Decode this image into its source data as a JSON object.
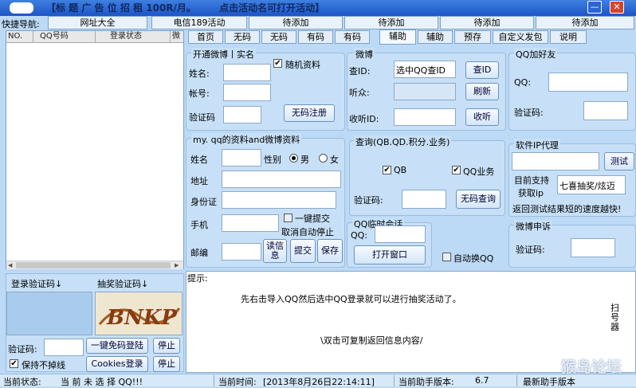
{
  "window": {
    "title": "【标 题 广 告 位 招 租 100R/月。       点击活动名可打开活动】",
    "minimize": "—",
    "close": "✕"
  },
  "quick_nav": {
    "label": "快捷导航:",
    "items": [
      "网址大全",
      "电信189活动",
      "待添加",
      "待添加",
      "待添加",
      "待添加"
    ]
  },
  "list": {
    "columns": [
      "NO.",
      "QQ号码",
      "登录状态",
      "微"
    ]
  },
  "tabs": [
    "首页",
    "无码",
    "无码",
    "有码",
    "有码",
    "辅助",
    "辅助",
    "预存",
    "自定义发包",
    "说明"
  ],
  "captcha": {
    "login_label": "登录验证码↓",
    "lottery_label": "抽奖验证码↓",
    "code_label": "验证码:",
    "one_click_btn": "一键免码登陆",
    "stop_btn": "停止",
    "cookies_btn": "Cookies登录",
    "stop_btn2": "停止",
    "keep_online": "保持不掉线",
    "captcha_text": "BNKP"
  },
  "weibo_open": {
    "title": "开通微博丨实名",
    "random_info": "随机资料",
    "name": "姓名:",
    "account": "帐号:",
    "code": "验证码",
    "register_btn": "无码注册"
  },
  "weibo": {
    "title": "微博",
    "id_label": "查ID:",
    "id_value": "选中QQ查ID",
    "check_id_btn": "查ID",
    "listeners": "听众:",
    "refresh_btn": "刷新",
    "listen_id": "收听ID:",
    "listen_btn": "收听"
  },
  "qq_friend": {
    "title": "QQ加好友",
    "qq": "QQ:",
    "code": "验证码:"
  },
  "profile": {
    "title": "my. qq的资料and微博资料",
    "name": "姓名",
    "gender": "性别",
    "male": "男",
    "female": "女",
    "address": "地址",
    "id_card": "身份证",
    "phone": "手机",
    "one_click_submit": "一键提交",
    "cancel_auto_stop": "取消自动停止",
    "zip": "邮编",
    "read_btn": "读信息",
    "submit_btn": "提交",
    "save_btn": "保存"
  },
  "query": {
    "title": "查询(QB.QD.积分.业务)",
    "qb": "QB",
    "qq_business": "QQ业务",
    "code": "验证码:",
    "query_btn": "无码查询"
  },
  "proxy": {
    "title": "软件IP代理",
    "test_btn": "测试",
    "supports": "目前支持",
    "get_ip": "获取ip",
    "support_value": "七喜抽奖/炫迈",
    "note": "返回测试结果短的速度越快!"
  },
  "temp_chat": {
    "title": "QQ临时会话",
    "qq": "QQ:",
    "open_btn": "打开窗口",
    "auto_switch": "自动换QQ"
  },
  "weibo_appeal": {
    "title": "微博申诉",
    "code": "验证码:"
  },
  "output": {
    "label": "提示:",
    "message": "先右击导入QQ然后选中QQ登录就可以进行抽奖活动了。",
    "copy_hint": "\\双击可复制返回信息内容/",
    "side_text": "扫号器"
  },
  "status": {
    "state_label": "当前状态:",
    "state_value": "当 前 未 选 择 QQ!!!",
    "time_label": "当前时间:",
    "time_value": "[2013年8月26日22:14:11]",
    "version_label": "当前助手版本:",
    "version_value": "6.7",
    "latest_label": "最新助手版本",
    "watermark": "猴岛论坛"
  }
}
